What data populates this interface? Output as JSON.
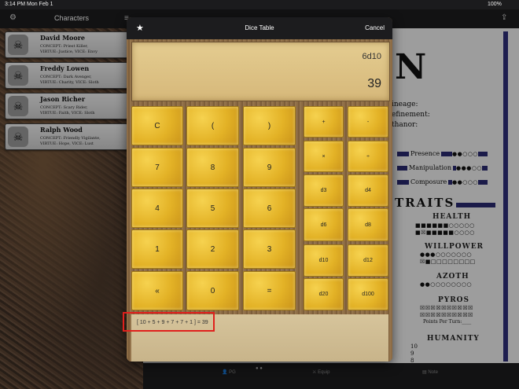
{
  "status_bar": {
    "time": "3:14 PM",
    "date": "Mon Feb 1",
    "battery": "100%"
  },
  "left_panel": {
    "title": "Characters",
    "characters": [
      {
        "name": "David Moore",
        "line1": "CONCEPT: Priest Killer,",
        "line2": "VIRTUE: Justice, VICE: Envy"
      },
      {
        "name": "Freddy Lowen",
        "line1": "CONCEPT: Dark Avenger,",
        "line2": "VIRTUE: Charity, VICE: Sloth"
      },
      {
        "name": "Jason Richer",
        "line1": "CONCEPT: Scary Rider,",
        "line2": "VIRTUE: Faith, VICE: Sloth"
      },
      {
        "name": "Ralph Wood",
        "line1": "CONCEPT: Friendly Vigilante,",
        "line2": "VIRTUE: Hope, VICE: Lust"
      }
    ]
  },
  "sheet": {
    "big_letter": "N",
    "meta": [
      "ineage:",
      "efinement:",
      "thanor:"
    ],
    "attributes": [
      {
        "label": "Presence",
        "dots": "●●○○○"
      },
      {
        "label": "Manipulation",
        "dots": "●●●○○"
      },
      {
        "label": "Composure",
        "dots": "●●○○○"
      }
    ],
    "traits_title": "TRAITS",
    "health": {
      "label": "HEALTH",
      "row1": "■■■■■■○○○○○",
      "row2": "■☒■■■■■○○○○"
    },
    "willpower": {
      "label": "WILLPOWER",
      "row1": "●●●○○○○○○○",
      "row2": "☒■□□□□□□□□"
    },
    "azoth": {
      "label": "AZOTH",
      "row1": "●●○○○○○○○○"
    },
    "pyros": {
      "label": "PYROS",
      "row1": "☒☒☒☒☒☒☒☒☒☒",
      "row2": "☒☒☒☒☒☒☒☒☒☒",
      "points": "Points Per Turn:____"
    },
    "humanity": {
      "label": "HUMANITY",
      "rows": [
        "10",
        "9",
        "8"
      ]
    }
  },
  "tabbar": {
    "tabs": [
      "PG",
      "Equip",
      "Note"
    ]
  },
  "modal": {
    "title": "Dice Table",
    "cancel": "Cancel",
    "expression": "6d10",
    "result": "39",
    "history_line": "[ 10 + 5 + 9 + 7 + 7 + 1 ] = 39",
    "main_keys": [
      [
        "C",
        "(",
        ")"
      ],
      [
        "7",
        "8",
        "9"
      ],
      [
        "4",
        "5",
        "6"
      ],
      [
        "1",
        "2",
        "3"
      ],
      [
        "«",
        "0",
        "="
      ]
    ],
    "side_keys": [
      [
        "+",
        "-"
      ],
      [
        "×",
        "÷"
      ],
      [
        "d3",
        "d4"
      ],
      [
        "d6",
        "d8"
      ],
      [
        "d10",
        "d12"
      ],
      [
        "d20",
        "d100"
      ]
    ]
  }
}
